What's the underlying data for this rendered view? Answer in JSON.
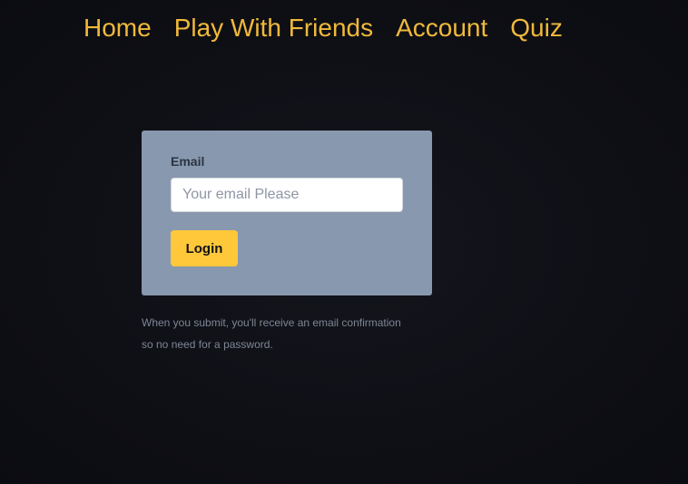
{
  "nav": {
    "items": [
      {
        "label": "Home"
      },
      {
        "label": "Play With Friends"
      },
      {
        "label": "Account"
      },
      {
        "label": "Quiz"
      }
    ]
  },
  "login_form": {
    "email_label": "Email",
    "email_placeholder": "Your email Please",
    "email_value": "",
    "submit_label": "Login"
  },
  "note": {
    "line1": "When you submit, you'll receive an email confirmation",
    "line2": "so no need for a password."
  },
  "colors": {
    "nav_link": "#f0b93a",
    "card_bg": "#8898ae",
    "button_bg": "#ffc83a",
    "page_bg": "#0f1016"
  }
}
